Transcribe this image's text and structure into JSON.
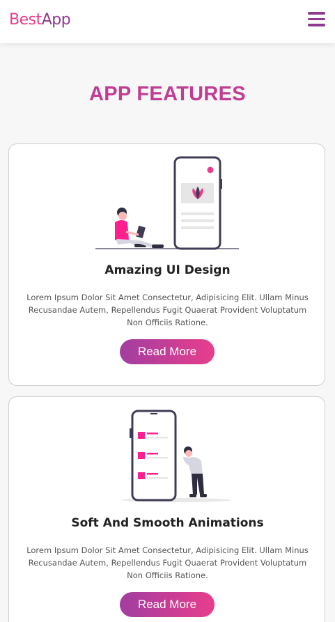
{
  "header": {
    "logo_part1": "Best",
    "logo_part2": "App",
    "menu_icon": "hamburger-menu-icon"
  },
  "section": {
    "title": "APP FEATURES"
  },
  "cards": [
    {
      "title": "Amazing UI Design",
      "text": "Lorem Ipsum Dolor Sit Amet Consectetur, Adipisicing Elit. Ullam Minus Recusandae Autem, Repellendus Fugit Quaerat Provident Voluptatum Non Officiis Ratione.",
      "button": "Read More",
      "illustration": "woman-with-laptop-beside-phone-illustration"
    },
    {
      "title": "Soft And Smooth Animations",
      "text": "Lorem Ipsum Dolor Sit Amet Consectetur, Adipisicing Elit. Ullam Minus Recusandae Autem, Repellendus Fugit Quaerat Provident Voluptatum Non Officiis Ratione.",
      "button": "Read More",
      "illustration": "man-standing-beside-phone-illustration"
    }
  ],
  "colors": {
    "brand_pink": "#e83e8c",
    "brand_purple": "#8e3b8f",
    "title_magenta": "#c03d93",
    "background": "#f7f7f7"
  }
}
